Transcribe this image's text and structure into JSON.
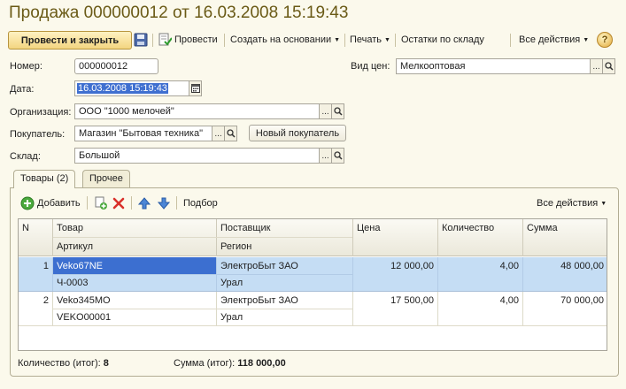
{
  "title": "Продажа 000000012 от 16.03.2008 15:19:43",
  "toolbar": {
    "post_close": "Провести и закрыть",
    "post": "Провести",
    "create_based": "Создать на основании",
    "print": "Печать",
    "stock": "Остатки по складу",
    "all_actions": "Все действия",
    "help": "?"
  },
  "form": {
    "number_label": "Номер:",
    "number": "000000012",
    "date_label": "Дата:",
    "date": "16.03.2008 15:19:43",
    "org_label": "Организация:",
    "org": "ООО \"1000 мелочей\"",
    "buyer_label": "Покупатель:",
    "buyer": "Магазин \"Бытовая техника\"",
    "new_buyer": "Новый покупатель",
    "warehouse_label": "Склад:",
    "warehouse": "Большой",
    "price_type_label": "Вид цен:",
    "price_type": "Мелкооптовая",
    "dots": "..."
  },
  "tabs": [
    "Товары (2)",
    "Прочее"
  ],
  "table_toolbar": {
    "add": "Добавить",
    "selection": "Подбор",
    "all_actions": "Все действия"
  },
  "table": {
    "headers": {
      "n": "N",
      "product": "Товар",
      "article": "Артикул",
      "supplier": "Поставщик",
      "region": "Регион",
      "price": "Цена",
      "qty": "Количество",
      "sum": "Сумма"
    },
    "rows": [
      {
        "n": "1",
        "product": "Veko67NE",
        "article": "Ч-0003",
        "supplier": "ЭлектроБыт ЗАО",
        "region": "Урал",
        "price": "12 000,00",
        "qty": "4,00",
        "sum": "48 000,00"
      },
      {
        "n": "2",
        "product": "Veko345MO",
        "article": "VEKO00001",
        "supplier": "ЭлектроБыт ЗАО",
        "region": "Урал",
        "price": "17 500,00",
        "qty": "4,00",
        "sum": "70 000,00"
      }
    ]
  },
  "totals": {
    "qty_label": "Количество (итог):",
    "qty": "8",
    "sum_label": "Сумма (итог):",
    "sum": "118 000,00"
  },
  "colors": {
    "title": "#6a5a16",
    "selection": "#3c6fd0",
    "row_selected": "#c5ddf4",
    "background": "#fbf9ec"
  }
}
